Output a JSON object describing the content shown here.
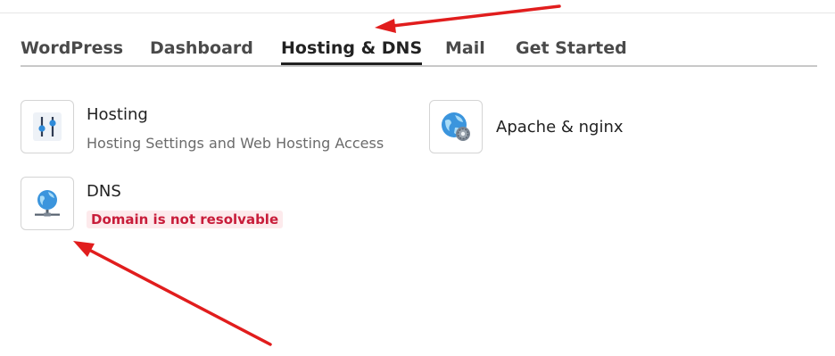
{
  "tabs": [
    {
      "label": "WordPress",
      "active": false
    },
    {
      "label": "Dashboard",
      "active": false
    },
    {
      "label": "Hosting & DNS",
      "active": true
    },
    {
      "label": "Mail",
      "active": false
    },
    {
      "label": "Get Started",
      "active": false
    }
  ],
  "items": {
    "hosting": {
      "icon": "sliders-icon",
      "title": "Hosting",
      "description": "Hosting Settings and Web Hosting Access"
    },
    "apache": {
      "icon": "globe-gear-icon",
      "title": "Apache & nginx"
    },
    "dns": {
      "icon": "globe-network-icon",
      "title": "DNS",
      "status": "Domain is not resolvable"
    }
  },
  "colors": {
    "accent_tab_underline": "#222222",
    "error_text": "#c81d3a",
    "error_background": "#fdeaec",
    "annotation_arrow": "#e11d1d"
  }
}
